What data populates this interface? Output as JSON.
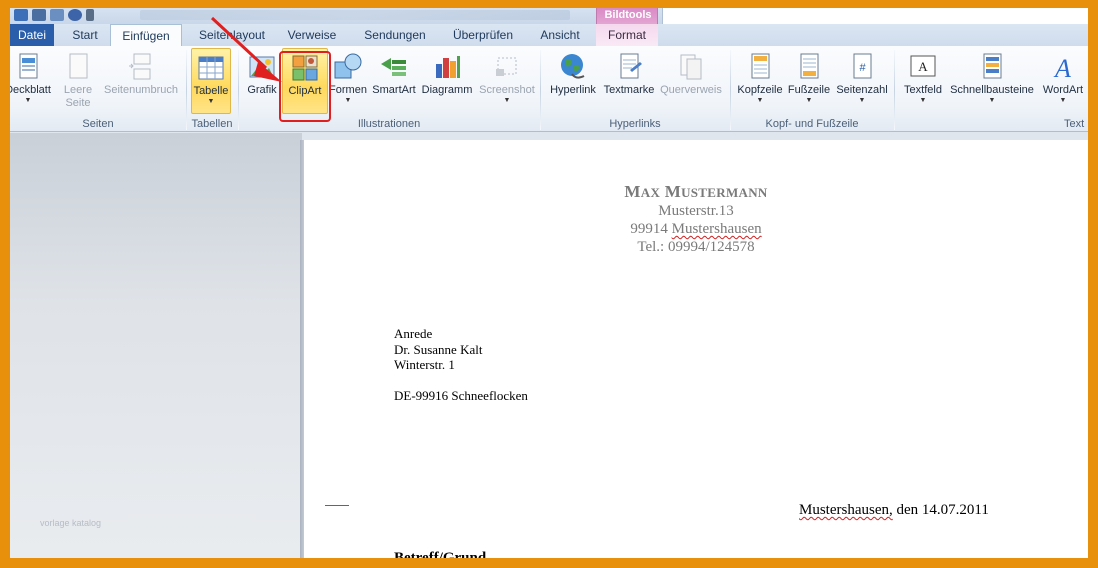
{
  "ribbon_tabs": [
    {
      "label": "Datei"
    },
    {
      "label": "Start"
    },
    {
      "label": "Einfügen"
    },
    {
      "label": "Seitenlayout"
    },
    {
      "label": "Verweise"
    },
    {
      "label": "Sendungen"
    },
    {
      "label": "Überprüfen"
    },
    {
      "label": "Ansicht"
    },
    {
      "label": "Format"
    }
  ],
  "contextual_title": "Bildtools",
  "groups": {
    "seiten": {
      "label": "Seiten",
      "buttons": [
        "Deckblatt",
        "Leere Seite",
        "Seitenumbruch"
      ]
    },
    "tabellen": {
      "label": "Tabellen",
      "buttons": [
        "Tabelle"
      ]
    },
    "illustrationen": {
      "label": "Illustrationen",
      "buttons": [
        "Grafik",
        "ClipArt",
        "Formen",
        "SmartArt",
        "Diagramm",
        "Screenshot"
      ]
    },
    "hyperlinks": {
      "label": "Hyperlinks",
      "buttons": [
        "Hyperlink",
        "Textmarke",
        "Querverweis"
      ]
    },
    "kopf": {
      "label": "Kopf- und Fußzeile",
      "buttons": [
        "Kopfzeile",
        "Fußzeile",
        "Seitenzahl"
      ]
    },
    "text": {
      "label": "Text",
      "buttons": [
        "Textfeld",
        "Schnellbausteine",
        "WordArt"
      ]
    }
  },
  "leere_seite_lines": [
    "Leere",
    "Seite"
  ],
  "document": {
    "sender_name_first_cap": "M",
    "sender_name_first_rest": "AX",
    "sender_name_last_cap": "M",
    "sender_name_last_rest": "USTERMANN",
    "street": "Musterstr.13",
    "city_zip": "99914",
    "city_name": "Mustershausen",
    "phone": "Tel.: 09994/124578",
    "recipient": [
      "Anrede",
      "Dr. Susanne Kalt",
      "Winterstr. 1",
      "DE-99916 Schneeflocken"
    ],
    "date_place": "Mustershausen,",
    "date_rest": " den 14.07.2011",
    "subject": "Betreff/Grund"
  },
  "watermark": "vorlage katalog",
  "colors": {
    "frame": "#e8900c",
    "file_tab": "#2a5daa",
    "highlight": "#e02020"
  }
}
